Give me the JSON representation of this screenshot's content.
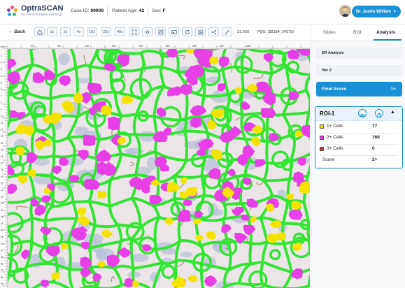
{
  "header": {
    "logo_name": "OptraSCAN",
    "logo_tagline": "On-Demand Digital Pathology",
    "case_id_label": "Case ID:",
    "case_id_value": "00008",
    "patient_age_label": "Patient Age:",
    "patient_age_value": "42",
    "sex_label": "Sex:",
    "sex_value": "F",
    "user_name": "Dr. Justin William"
  },
  "toolbar": {
    "back_label": "Back",
    "zoom_buttons": [
      "1x",
      "2x",
      "4x",
      "10x",
      "20x",
      "40x"
    ],
    "tool_icons": [
      "fit-screen-icon",
      "brightness-icon",
      "annotation-icon",
      "thumbnail-icon",
      "rotate-icon",
      "image-icon",
      "share-icon",
      "measure-icon"
    ],
    "zoom_readout": "31.95X",
    "position_readout": "POS: (28184, 24575)"
  },
  "rulers": {
    "top_unit": "mm",
    "top_ticks": [
      "40",
      "80",
      "120",
      "160",
      "200",
      "240",
      "280",
      "320",
      "360"
    ],
    "left_ticks": [
      "1",
      "2",
      "3",
      "4",
      "5",
      "6",
      "7",
      "8",
      "9",
      "10",
      "11",
      "12",
      "13",
      "14",
      "15",
      "16",
      "17",
      "18",
      "19",
      "20",
      "21",
      "22",
      "23",
      "24",
      "25",
      "26",
      "27",
      "28",
      "29",
      "30",
      "31",
      "32",
      "33",
      "34",
      "35"
    ]
  },
  "panel": {
    "tabs": [
      "Slides",
      "ROI",
      "Analysis"
    ],
    "active_tab": "Analysis",
    "sections": [
      "ER Analysis",
      "Her 2"
    ],
    "final_score_label": "Final Score",
    "final_score_value": "1+",
    "roi": {
      "title": "ROI-1",
      "rows": [
        {
          "name": "1+ Cells",
          "value": "77",
          "color": "#f5e200"
        },
        {
          "name": "2+ Cells",
          "value": "166",
          "color": "#e83ee8"
        },
        {
          "name": "3+ Cells",
          "value": "0",
          "color": "#c0392b"
        },
        {
          "name": "Score",
          "value": "2+",
          "color": ""
        }
      ]
    }
  },
  "colors": {
    "accent": "#1a91d6",
    "membrane": "#33e533",
    "cell_1plus": "#f5e200",
    "cell_2plus": "#e83ee8"
  }
}
